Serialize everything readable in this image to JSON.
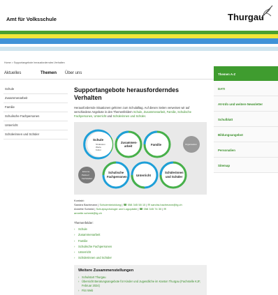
{
  "header": {
    "department": "Amt für Volksschule",
    "brand": "Thurgau"
  },
  "colors": {
    "green": "#4a9f2f",
    "yellow": "#f2e63a",
    "blue": "#3f92d8",
    "lightblue": "#cfe4ee"
  },
  "breadcrumb": "Home > Supportangebote herausforderndes Verhalten",
  "nav": {
    "items": [
      "Aktuelles",
      "Themen",
      "Über uns"
    ],
    "active": "Themen"
  },
  "sidebar": {
    "items": [
      "Schule",
      "Zusammenarbeit",
      "Familie",
      "Schulische Fachpersonen",
      "Unterricht",
      "Schülerinnen und Schüler"
    ]
  },
  "content": {
    "title": "Supportangebote herausforderndes Verhalten",
    "intro_text": "Herausfordernde Situationen gehören zum Schulalltag. Auf diesen Seiten verweisen wir auf verschiedene Angebote in den Themenfeldern ",
    "intro_links": [
      "Schule",
      "Zusammenarbeit",
      "Familie",
      "Schulische Fachpersonen",
      "Unterricht",
      "Schülerinnen und Schüler"
    ],
    "intro_sep1": ", ",
    "intro_and": " und ",
    "intro_end": ".",
    "diagram": {
      "schule": "Schule",
      "schule_sub": [
        "Strukturen",
        "Werte",
        "Kultur"
      ],
      "zusammenarbeit_1": "Zusammen-",
      "zusammenarbeit_2": "arbeit",
      "familie": "Familie",
      "organisation": "Organisation",
      "extern_1": "Externe",
      "extern_2": "Partner/",
      "extern_3": "Fachstellen",
      "fach_1": "Schulische",
      "fach_2": "Fachpersonen",
      "unterricht": "Unterricht",
      "schueler_1": "Schülerinnen",
      "schueler_2": "und Schüler"
    },
    "contact": {
      "label": "Kontakt:",
      "line1_name": "Sandra Bachmann",
      "line1_role": "Schulentwicklung",
      "line1_phone": "058 345 58 10",
      "line1_email": "sandra.bachmann@tg.ch",
      "line2_name": "Annette Schmid",
      "line2_role": "Schulpsychologie und Logopädie",
      "line2_phone": "058 345 74 30",
      "line3_email": "annette.schmid@tg.ch"
    },
    "themes_label": "Themenfelder:",
    "themes": [
      "Schule",
      "Zusammenarbeit",
      "Familie",
      "Schulische Fachpersonen",
      "Unterricht",
      "Schülerinnen und Schüler"
    ],
    "more": {
      "title": "Weitere Zusammenstellungen",
      "items": [
        "Schulstart Thurgau",
        "Übersicht Beratungsangebote für Kinder und Jugendliche im Kanton Thurgau (Fachstelle KJF, Februar 2024)",
        "Fit4 Web"
      ]
    }
  },
  "rightnav": {
    "items": [
      "Themen A-Z",
      "DATI",
      "AV-Info und weitere Newsletter",
      "Schulblatt",
      "Bildungsangebot",
      "Personalien",
      "Sitemap"
    ],
    "active": "Themen A-Z"
  }
}
